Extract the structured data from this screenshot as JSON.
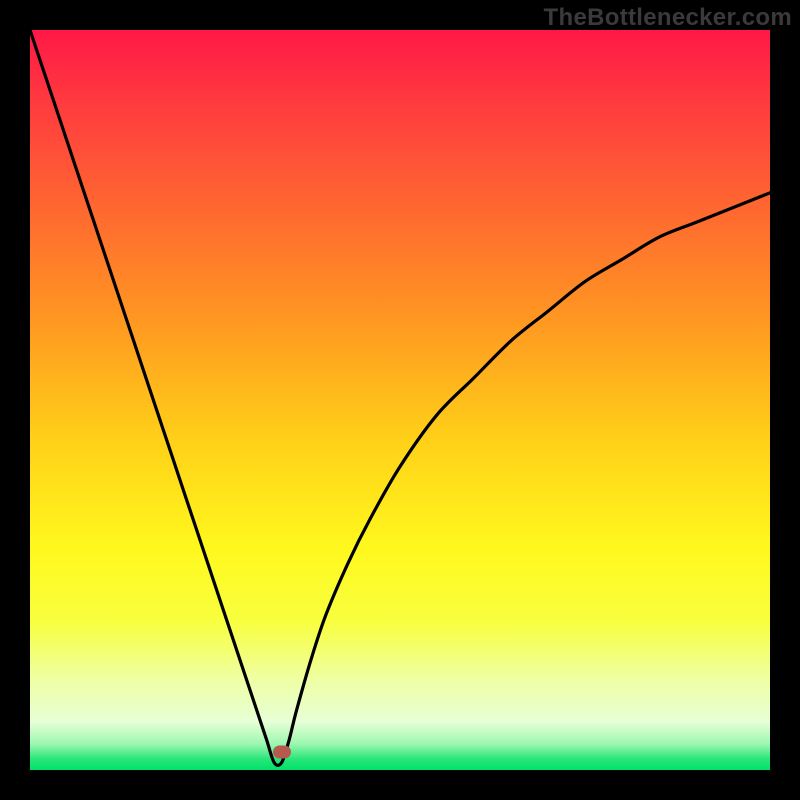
{
  "watermark": {
    "text": "TheBottlenecker.com"
  },
  "chart_data": {
    "type": "line",
    "title": "",
    "xlabel": "",
    "ylabel": "",
    "xlim": [
      0,
      100
    ],
    "ylim": [
      0,
      100
    ],
    "vertex_x": 33,
    "marker": {
      "x": 34,
      "y": 2.5,
      "color": "#b6594e"
    },
    "gradient_stops": [
      {
        "offset": 0,
        "color": "#ff1846"
      },
      {
        "offset": 0.1,
        "color": "#ff3b3f"
      },
      {
        "offset": 0.25,
        "color": "#ff6a2f"
      },
      {
        "offset": 0.4,
        "color": "#ff9a21"
      },
      {
        "offset": 0.55,
        "color": "#ffcf18"
      },
      {
        "offset": 0.7,
        "color": "#fff81d"
      },
      {
        "offset": 0.8,
        "color": "#f8ff3f"
      },
      {
        "offset": 0.88,
        "color": "#efffa6"
      },
      {
        "offset": 0.935,
        "color": "#e6ffd6"
      },
      {
        "offset": 0.965,
        "color": "#9cf7b0"
      },
      {
        "offset": 0.985,
        "color": "#29e67a"
      },
      {
        "offset": 1.0,
        "color": "#00e26b"
      }
    ],
    "series": [
      {
        "name": "curve",
        "x": [
          0,
          2,
          4,
          6,
          8,
          10,
          12,
          14,
          16,
          18,
          20,
          22,
          24,
          26,
          28,
          30,
          31,
          32,
          33,
          34,
          35,
          36,
          38,
          40,
          43,
          46,
          50,
          55,
          60,
          65,
          70,
          75,
          80,
          85,
          90,
          95,
          100
        ],
        "y": [
          100,
          94,
          88,
          82,
          76,
          70,
          64,
          58,
          52,
          46,
          40,
          34,
          28,
          22,
          16,
          10,
          7,
          4,
          1,
          1,
          4,
          8,
          15,
          21,
          28,
          34,
          41,
          48,
          53,
          58,
          62,
          66,
          69,
          72,
          74,
          76,
          78
        ]
      }
    ]
  }
}
